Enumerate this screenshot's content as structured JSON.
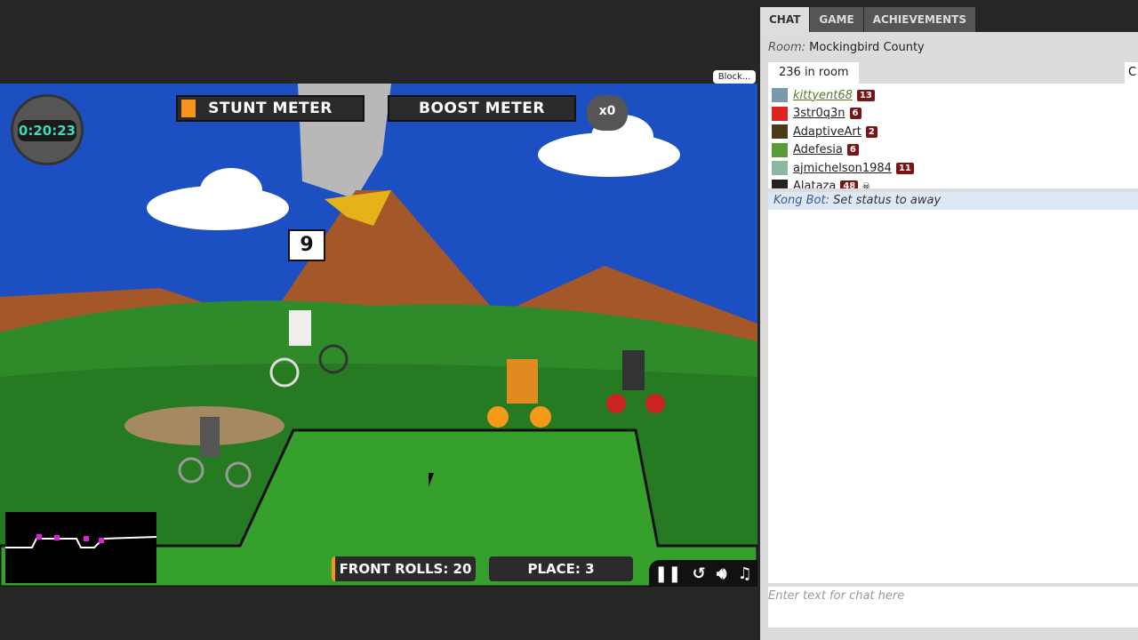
{
  "game": {
    "timer": "0:20:23",
    "stunt_meter_label": "STUNT METER",
    "stunt_meter_fill": 0.08,
    "boost_meter_label": "BOOST METER",
    "boost_count": "x0",
    "trick_bubble": "9",
    "front_rolls": "FRONT ROLLS: 20",
    "place": "PLACE: 3",
    "controls": [
      "pause-icon",
      "restart-icon",
      "sound-icon",
      "music-icon"
    ],
    "accent": "#f7941d"
  },
  "block_button": "Block...",
  "chat": {
    "tabs": [
      {
        "label": "CHAT",
        "active": true
      },
      {
        "label": "GAME"
      },
      {
        "label": "ACHIEVEMENTS"
      }
    ],
    "room_label": "Room:",
    "room_name": "Mockingbird County",
    "room_count": "236 in room",
    "partial_button": "C",
    "users": [
      {
        "name": "kittyent68",
        "level": "13"
      },
      {
        "name": "3str0q3n",
        "level": "6"
      },
      {
        "name": "AdaptiveArt",
        "level": "2"
      },
      {
        "name": "Adefesia",
        "level": "6"
      },
      {
        "name": "ajmichelson1984",
        "level": "11"
      },
      {
        "name": "Alataza",
        "level": "48"
      }
    ],
    "bot_name": "Kong Bot:",
    "bot_message": "Set status to away",
    "input_placeholder": "Enter text for chat here"
  }
}
